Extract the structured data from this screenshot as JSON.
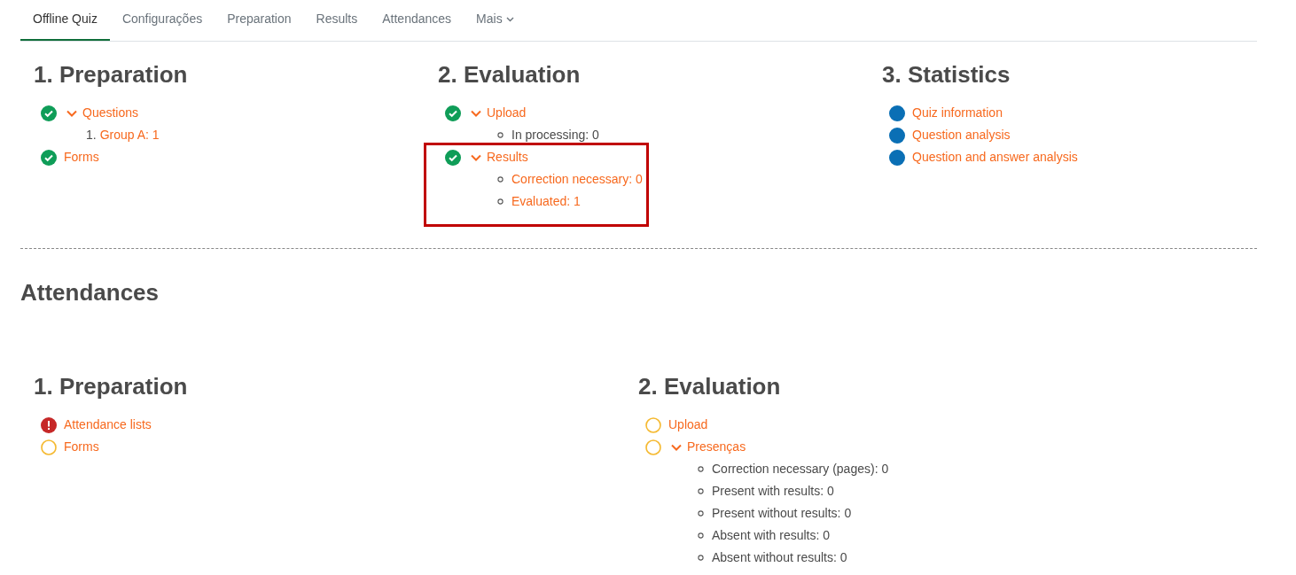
{
  "tabs": [
    {
      "label": "Offline Quiz",
      "selected": true,
      "kind": "tab"
    },
    {
      "label": "Configurações",
      "selected": false,
      "kind": "tab"
    },
    {
      "label": "Preparation",
      "selected": false,
      "kind": "tab"
    },
    {
      "label": "Results",
      "selected": false,
      "kind": "tab"
    },
    {
      "label": "Attendances",
      "selected": false,
      "kind": "tab"
    },
    {
      "label": "Mais",
      "selected": false,
      "kind": "menu"
    }
  ],
  "sections": [
    {
      "columns": [
        {
          "heading": "1. Preparation",
          "items": [
            {
              "kind": "done",
              "label": "Questions",
              "expanded": true,
              "highlighted": false,
              "children": [
                {
                  "number": "1.",
                  "label": "Group A: 1",
                  "link": true
                }
              ]
            },
            {
              "kind": "done",
              "label": "Forms",
              "expanded": false,
              "highlighted": false
            }
          ]
        },
        {
          "heading": "2. Evaluation",
          "items": [
            {
              "kind": "done",
              "label": "Upload",
              "expanded": true,
              "highlighted": false,
              "children": [
                {
                  "label": "In processing: 0",
                  "link": false
                }
              ]
            },
            {
              "kind": "done",
              "label": "Results",
              "expanded": true,
              "highlighted": true,
              "children": [
                {
                  "label": "Correction necessary: 0",
                  "link": true
                },
                {
                  "label": "Evaluated: 1",
                  "link": true
                }
              ]
            }
          ]
        },
        {
          "heading": "3. Statistics",
          "items": [
            {
              "kind": "info",
              "label": "Quiz information",
              "expanded": false,
              "highlighted": false
            },
            {
              "kind": "info",
              "label": "Question analysis",
              "expanded": false,
              "highlighted": false
            },
            {
              "kind": "info",
              "label": "Question and answer analysis",
              "expanded": false,
              "highlighted": false
            }
          ]
        }
      ]
    },
    {
      "title": "Attendances",
      "columns": [
        {
          "heading": "1. Preparation",
          "items": [
            {
              "kind": "error",
              "label": "Attendance lists",
              "expanded": false,
              "highlighted": false
            },
            {
              "kind": "pending",
              "label": "Forms",
              "expanded": false,
              "highlighted": false
            }
          ]
        },
        {
          "heading": "2. Evaluation",
          "items": [
            {
              "kind": "pending",
              "label": "Upload",
              "expanded": false,
              "highlighted": false
            },
            {
              "kind": "pending",
              "label": "Presenças",
              "expanded": true,
              "highlighted": false,
              "children": [
                {
                  "label": "Correction necessary (pages): 0",
                  "link": false
                },
                {
                  "label": "Present with results: 0",
                  "link": false
                },
                {
                  "label": "Present without results: 0",
                  "link": false
                },
                {
                  "label": "Absent with results: 0",
                  "link": false
                },
                {
                  "label": "Absent without results: 0",
                  "link": false
                }
              ]
            }
          ]
        }
      ]
    }
  ]
}
